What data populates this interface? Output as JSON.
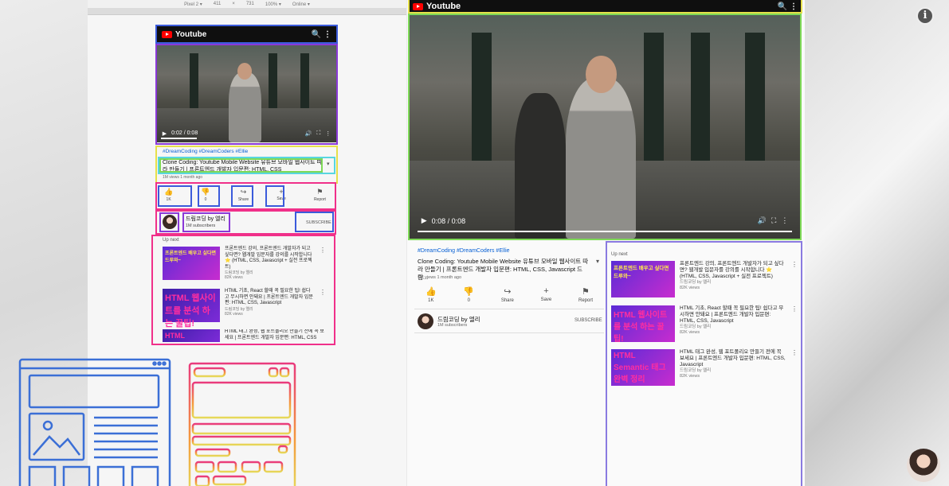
{
  "device_toolbar": {
    "device": "Pixel 2 ▾",
    "width": "411",
    "times": "×",
    "height": "731",
    "zoom": "100% ▾",
    "network": "Online ▾"
  },
  "brand": {
    "app_name": "Youtube",
    "icons": "🔍 ⋮",
    "logo_color": "#ff0000",
    "header_bg": "#0f0f0f"
  },
  "small": {
    "time": "0:02 / 0:08",
    "tags": "#DreamCoding #DreamCoders #Ellie",
    "title": "Clone Coding: Youtube Mobile Website 유튜브 모바일 웹사이트 따라 만들기 | 프론트엔드 개발자 입문편: HTML, CSS",
    "meta": "1M views 1 month ago",
    "actions": [
      {
        "icon": "👍",
        "label": "1K"
      },
      {
        "icon": "👎",
        "label": "0"
      },
      {
        "icon": "↪",
        "label": "Share"
      },
      {
        "icon": "+",
        "label": "Save"
      },
      {
        "icon": "⚑",
        "label": "Report"
      }
    ],
    "channel": "드림코딩 by 엘리",
    "subs": "1M subscribers",
    "subscribe": "SUBSCRIBE",
    "up_next": "Up next",
    "items": [
      {
        "thumb": "프론트엔드 배우고 싶다면 드루와~",
        "title": "프론트엔드 강의, 프론트엔드 개발자가 되고 싶다면? 웹개발 입문자를 강의를 시작합니다 ⭐ (HTML, CSS, Javascript + 실전 프로젝트)",
        "channel": "드림코딩 by 엘리",
        "views": "82K views"
      },
      {
        "thumb": "HTML 웹사이트를 분석 하는 꿀팁!",
        "title": "HTML 기초, React 할때 꼭 필요한 팁! 쉽다고 무시하면 안돼요 | 프론트엔드 개발자 입문편: HTML, CSS, Javascript",
        "channel": "드림코딩 by 엘리",
        "views": "82K views"
      },
      {
        "thumb": "HTML",
        "title": "HTML 태그 완성, 웹 포트폴리오 만들기 전에 꼭 보세요 | 프론트엔드 개발자 입문편: HTML, CSS",
        "channel": "",
        "views": ""
      }
    ]
  },
  "big": {
    "time": "0:08 / 0:08",
    "tags": "#DreamCoding #DreamCoders #Ellie",
    "title": "Clone Coding: Youtube Mobile Website 유튜브 모바일 웹사이트 따라 만들기 | 프론트엔드 개발자 입문편: HTML, CSS, Javascript 드림...",
    "meta": "1M views 1 month ago",
    "actions": [
      {
        "icon": "👍",
        "label": "1K"
      },
      {
        "icon": "👎",
        "label": "0"
      },
      {
        "icon": "↪",
        "label": "Share"
      },
      {
        "icon": "+",
        "label": "Save"
      },
      {
        "icon": "⚑",
        "label": "Report"
      }
    ],
    "channel": "드림코딩 by 엘리",
    "subs": "1M subscribers",
    "subscribe": "SUBSCRIBE",
    "up_next": "Up next",
    "items": [
      {
        "thumb": "프론트엔드 배우고 싶다면 드루와~",
        "title": "프론트엔드 강의, 프론트엔드 개발자가 되고 싶다면? 웹개발 입문자를 강의를 시작합니다 ⭐ (HTML, CSS, Javascript + 실전 프로젝트)",
        "channel": "드림코딩 by 엘리",
        "views": "82K views"
      },
      {
        "thumb": "HTML 웹사이트를 분석 하는 꿀팁!",
        "title": "HTML 기초, React 할때 꼭 필요한 팁! 쉽다고 무시하면 안돼요 | 프론트엔드 개발자 입문편: HTML, CSS, Javascript",
        "channel": "드림코딩 by 엘리",
        "views": "82K views"
      },
      {
        "thumb": "HTML Semantic 태그 완벽 정리",
        "title": "HTML 태그 완성, 웹 포트폴리오 만들기 전에 꼭 보세요 | 프론트엔드 개발자 입문편: HTML, CSS, Javascript",
        "channel": "드림코딩 by 엘리",
        "views": "82K views"
      }
    ]
  },
  "colors": {
    "blue": "#3b5bdb",
    "purple": "#8a39d8",
    "green": "#7ed957",
    "yellow": "#e6e04a",
    "pink": "#f0308a",
    "cyan": "#59d6e0"
  }
}
